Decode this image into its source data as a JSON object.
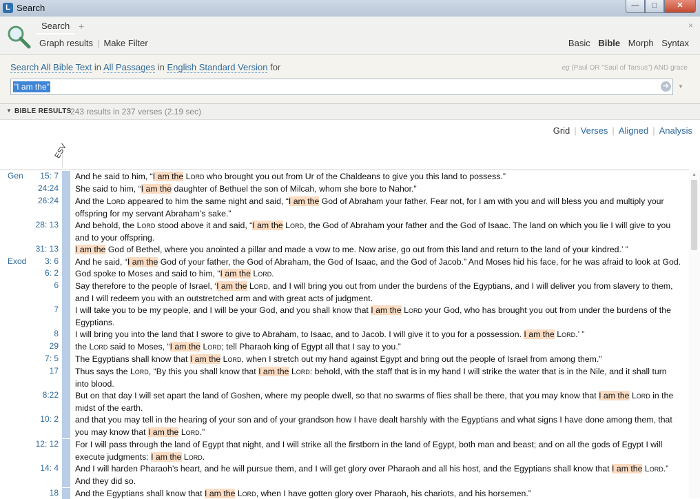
{
  "window": {
    "title": "Search"
  },
  "tabs": {
    "active": "Search",
    "add": "+",
    "close": "×"
  },
  "header": {
    "links": [
      "Graph results",
      "Make Filter"
    ],
    "modes": [
      "Basic",
      "Bible",
      "Morph",
      "Syntax"
    ],
    "active_mode": "Bible"
  },
  "query": {
    "search": "Search",
    "scope_text": "All Bible Text",
    "in1": "in",
    "passages": "All Passages",
    "in2": "in",
    "version": "English Standard Version",
    "for": "for",
    "example_label": "eg",
    "example": "(Paul OR \"Saul of Tarsus\") AND grace",
    "input_value": "\"I am the\""
  },
  "results_bar": {
    "title": "BIBLE RESULTS",
    "summary": "243 results in 237 verses (2.19 sec)"
  },
  "views": [
    "Grid",
    "Verses",
    "Aligned",
    "Analysis"
  ],
  "column_header": "ESV",
  "results": [
    {
      "book": "Gen",
      "ref": "15: 7",
      "parts": [
        [
          "And he said to him, “",
          ""
        ],
        [
          "I am the",
          "hl"
        ],
        [
          " ",
          ""
        ],
        [
          "Lord",
          "sc"
        ],
        [
          " who brought you out from Ur of the Chaldeans to give you this land to possess.”",
          ""
        ]
      ]
    },
    {
      "book": "",
      "ref": "24:24",
      "parts": [
        [
          "She said to him, “",
          ""
        ],
        [
          "I am the",
          "hl"
        ],
        [
          " daughter of Bethuel the son of Milcah, whom she bore to Nahor.”",
          ""
        ]
      ]
    },
    {
      "book": "",
      "ref": "26:24",
      "parts": [
        [
          "And the ",
          ""
        ],
        [
          "Lord",
          "sc"
        ],
        [
          " appeared to him the same night and said, “",
          ""
        ],
        [
          "I am the",
          "hl"
        ],
        [
          " God of Abraham your father. Fear not, for I am with you and will bless you and multiply your offspring for my servant Abraham’s sake.”",
          ""
        ]
      ]
    },
    {
      "book": "",
      "ref": "28: 13",
      "parts": [
        [
          "And behold, the ",
          ""
        ],
        [
          "Lord",
          "sc"
        ],
        [
          " stood above it and said, “",
          ""
        ],
        [
          "I am the",
          "hl"
        ],
        [
          " ",
          ""
        ],
        [
          "Lord",
          "sc"
        ],
        [
          ", the God of Abraham your father and the God of Isaac. The land on which you lie I will give to you and to your offspring.",
          ""
        ]
      ]
    },
    {
      "book": "",
      "ref": "31: 13",
      "parts": [
        [
          "I am the",
          "hl"
        ],
        [
          " God of Bethel, where you anointed a pillar and made a vow to me. Now arise, go out from this land and return to the land of your kindred.’ ”",
          ""
        ]
      ]
    },
    {
      "book": "Exod",
      "ref": "3: 6",
      "parts": [
        [
          "And he said, “",
          ""
        ],
        [
          "I am the",
          "hl"
        ],
        [
          " God of your father, the God of Abraham, the God of Isaac, and the God of Jacob.” And Moses hid his face, for he was afraid to look at God.",
          ""
        ]
      ]
    },
    {
      "book": "",
      "ref": "6: 2",
      "parts": [
        [
          "God spoke to Moses and said to him, “",
          ""
        ],
        [
          "I am the",
          "hl"
        ],
        [
          " ",
          ""
        ],
        [
          "Lord",
          "sc"
        ],
        [
          ".",
          ""
        ]
      ]
    },
    {
      "book": "",
      "ref": "6",
      "parts": [
        [
          "Say therefore to the people of Israel, ‘",
          ""
        ],
        [
          "I am the",
          "hl"
        ],
        [
          " ",
          ""
        ],
        [
          "Lord",
          "sc"
        ],
        [
          ", and I will bring you out from under the burdens of the Egyptians, and I will deliver you from slavery to them, and I will redeem you with an outstretched arm and with great acts of judgment.",
          ""
        ]
      ]
    },
    {
      "book": "",
      "ref": "7",
      "parts": [
        [
          "I will take you to be my people, and I will be your God, and you shall know that ",
          ""
        ],
        [
          "I am the",
          "hl"
        ],
        [
          " ",
          ""
        ],
        [
          "Lord",
          "sc"
        ],
        [
          " your God, who has brought you out from under the burdens of the Egyptians.",
          ""
        ]
      ]
    },
    {
      "book": "",
      "ref": "8",
      "parts": [
        [
          "I will bring you into the land that I swore to give to Abraham, to Isaac, and to Jacob. I will give it to you for a possession. ",
          ""
        ],
        [
          "I am the",
          "hl"
        ],
        [
          " ",
          ""
        ],
        [
          "Lord",
          "sc"
        ],
        [
          ".’ ”",
          ""
        ]
      ]
    },
    {
      "book": "",
      "ref": "29",
      "parts": [
        [
          "the ",
          ""
        ],
        [
          "Lord",
          "sc"
        ],
        [
          " said to Moses, “",
          ""
        ],
        [
          "I am the",
          "hl"
        ],
        [
          " ",
          ""
        ],
        [
          "Lord",
          "sc"
        ],
        [
          "; tell Pharaoh king of Egypt all that I say to you.”",
          ""
        ]
      ]
    },
    {
      "book": "",
      "ref": "7: 5",
      "parts": [
        [
          "The Egyptians shall know that ",
          ""
        ],
        [
          "I am the",
          "hl"
        ],
        [
          " ",
          ""
        ],
        [
          "Lord",
          "sc"
        ],
        [
          ", when I stretch out my hand against Egypt and bring out the people of Israel from among them.”",
          ""
        ]
      ]
    },
    {
      "book": "",
      "ref": "17",
      "parts": [
        [
          "Thus says the ",
          ""
        ],
        [
          "Lord",
          "sc"
        ],
        [
          ", “By this you shall know that ",
          ""
        ],
        [
          "I am the",
          "hl"
        ],
        [
          " ",
          ""
        ],
        [
          "Lord",
          "sc"
        ],
        [
          ": behold, with the staff that is in my hand I will strike the water that is in the Nile, and it shall turn into blood.",
          ""
        ]
      ]
    },
    {
      "book": "",
      "ref": "8:22",
      "parts": [
        [
          "But on that day I will set apart the land of Goshen, where my people dwell, so that no swarms of flies shall be there, that you may know that ",
          ""
        ],
        [
          "I am the",
          "hl"
        ],
        [
          " ",
          ""
        ],
        [
          "Lord",
          "sc"
        ],
        [
          " in the midst of the earth.",
          ""
        ]
      ]
    },
    {
      "book": "",
      "ref": "10: 2",
      "parts": [
        [
          "and that you may tell in the hearing of your son and of your grandson how I have dealt harshly with the Egyptians and what signs I have done among them, that you may know that ",
          ""
        ],
        [
          "I am the",
          "hl"
        ],
        [
          " ",
          ""
        ],
        [
          "Lord",
          "sc"
        ],
        [
          ".”",
          ""
        ]
      ]
    },
    {
      "book": "",
      "ref": "12: 12",
      "parts": [
        [
          "For I will pass through the land of Egypt that night, and I will strike all the firstborn in the land of Egypt, both man and beast; and on all the gods of Egypt I will execute judgments: ",
          ""
        ],
        [
          "I am the",
          "hl"
        ],
        [
          " ",
          ""
        ],
        [
          "Lord",
          "sc"
        ],
        [
          ".",
          ""
        ]
      ]
    },
    {
      "book": "",
      "ref": "14: 4",
      "parts": [
        [
          "And I will harden Pharaoh’s heart, and he will pursue them, and I will get glory over Pharaoh and all his host, and the Egyptians shall know that ",
          ""
        ],
        [
          "I am the",
          "hl"
        ],
        [
          " ",
          ""
        ],
        [
          "Lord",
          "sc"
        ],
        [
          ".” And they did so.",
          ""
        ]
      ]
    },
    {
      "book": "",
      "ref": "18",
      "parts": [
        [
          "And the Egyptians shall know that ",
          ""
        ],
        [
          "I am the",
          "hl"
        ],
        [
          " ",
          ""
        ],
        [
          "Lord",
          "sc"
        ],
        [
          ", when I have gotten glory over Pharaoh, his chariots, and his horsemen.”",
          ""
        ]
      ]
    }
  ]
}
